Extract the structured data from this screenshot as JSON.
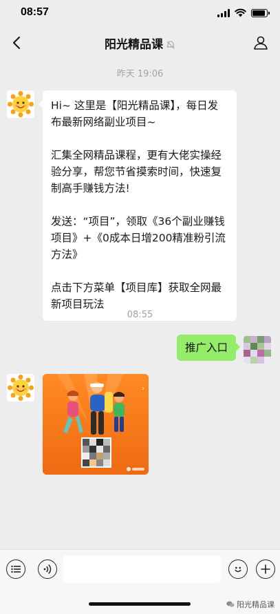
{
  "status_bar": {
    "time": "08:57",
    "battery_level": 0.9
  },
  "nav": {
    "title": "阳光精品课",
    "muted": true
  },
  "messages": {
    "time_1": "昨天 19:06",
    "welcome": {
      "paragraphs": [
        "Hi~ 这里是【阳光精品课】，每日发布最新网络副业项目~",
        "汇集全网精品课程，更有大佬实操经验分享，帮您节省摸索时间，快速复制高手赚钱方法!",
        "发送：“项目”，领取《36个副业赚钱项目》+《0成本日增200精准粉引流方法》",
        "点击下方菜单【项目库】获取全网最新项目玩法"
      ]
    },
    "time_2": "08:55",
    "sent": {
      "text": "推广入口"
    }
  },
  "watermark": "阳光精品课",
  "icons": {
    "back": "chevron-left-icon",
    "mute": "bell-off-icon",
    "profile": "person-icon",
    "menu": "list-icon",
    "voice": "voice-icon",
    "emoji": "smile-icon",
    "plus": "plus-icon"
  }
}
